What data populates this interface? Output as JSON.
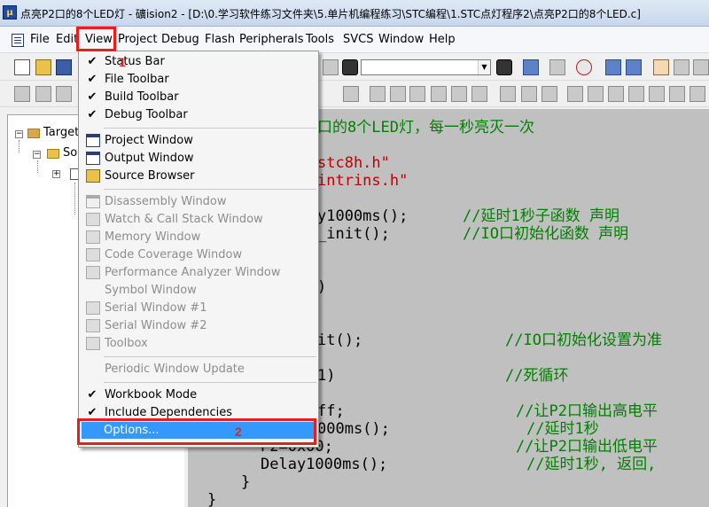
{
  "window": {
    "title": "点亮P2口的8个LED灯  - 礦ision2 - [D:\\0.学习软件练习文件夹\\5.单片机编程练习\\STC编程\\1.STC点灯程序2\\点亮P2口的8个LED.c]"
  },
  "menubar": {
    "items": [
      {
        "id": "file",
        "label": "File"
      },
      {
        "id": "edit",
        "label": "Edit"
      },
      {
        "id": "view",
        "label": "View"
      },
      {
        "id": "project",
        "label": "Project"
      },
      {
        "id": "debug",
        "label": "Debug"
      },
      {
        "id": "flash",
        "label": "Flash"
      },
      {
        "id": "peripherals",
        "label": "Peripherals"
      },
      {
        "id": "tools",
        "label": "Tools"
      },
      {
        "id": "svcs",
        "label": "SVCS"
      },
      {
        "id": "window",
        "label": "Window"
      },
      {
        "id": "help",
        "label": "Help"
      }
    ]
  },
  "toolbar": {
    "find_combo_value": ""
  },
  "view_menu": {
    "items": [
      {
        "label": "Status Bar",
        "checked": true,
        "enabled": true
      },
      {
        "label": "File Toolbar",
        "checked": true,
        "enabled": true
      },
      {
        "label": "Build Toolbar",
        "checked": true,
        "enabled": true
      },
      {
        "label": "Debug Toolbar",
        "checked": true,
        "enabled": true
      },
      {
        "label": "Project Window",
        "icon": "project-window-icon",
        "enabled": true
      },
      {
        "label": "Output Window",
        "icon": "output-window-icon",
        "enabled": true
      },
      {
        "label": "Source Browser",
        "icon": "source-browser-icon",
        "enabled": true
      },
      {
        "label": "Disassembly Window",
        "icon": "disassembly-window-icon",
        "enabled": false
      },
      {
        "label": "Watch & Call Stack Window",
        "icon": "watch-window-icon",
        "enabled": false
      },
      {
        "label": "Memory Window",
        "icon": "memory-window-icon",
        "enabled": false
      },
      {
        "label": "Code Coverage Window",
        "icon": "code-coverage-icon",
        "enabled": false
      },
      {
        "label": "Performance Analyzer Window",
        "icon": "performance-analyzer-icon",
        "enabled": false
      },
      {
        "label": "Symbol Window",
        "enabled": false
      },
      {
        "label": "Serial  Window #1",
        "icon": "serial-window-icon",
        "enabled": false
      },
      {
        "label": "Serial  Window #2",
        "icon": "serial-window-icon",
        "enabled": false
      },
      {
        "label": "Toolbox",
        "icon": "toolbox-icon",
        "enabled": false
      },
      {
        "label": "Periodic Window Update",
        "enabled": false
      },
      {
        "label": "Workbook Mode",
        "checked": true,
        "enabled": true
      },
      {
        "label": "Include Dependencies",
        "checked": true,
        "enabled": true
      }
    ],
    "highlighted_item": "Options...",
    "checkmark": "✔"
  },
  "project_tree": {
    "root_label": "Target",
    "group_label": "So"
  },
  "editor": {
    "lines": [
      {
        "text": "口的8个LED灯，每一秒亮灭一次",
        "kind": "comment"
      },
      {
        "text": "stc8h.h\"",
        "kind": "string"
      },
      {
        "text": "intrins.h\"",
        "kind": "string"
      },
      {
        "text": "y1000ms();    //延时1秒子函数 声明",
        "kind": "mixed",
        "code": "y1000ms();",
        "comment": "//延时1秒子函数 声明"
      },
      {
        "text": "_init();      //IO口初始化函数 声明",
        "kind": "mixed",
        "code": "_init();",
        "comment": "//IO口初始化函数 声明"
      },
      {
        "text": ")",
        "kind": "normal"
      },
      {
        "text": "it();",
        "kind": "mixed",
        "code": "it();",
        "comment": "//IO口初始化设置为准"
      },
      {
        "text": "1)",
        "kind": "mixed",
        "code": "1)",
        "comment": "//死循环"
      },
      {
        "text": "ff;",
        "kind": "mixed",
        "code": "ff;",
        "comment": "//让P2口输出高电平"
      },
      {
        "text": "000ms();",
        "kind": "mixed",
        "code": "000ms();",
        "comment": "//延时1秒"
      },
      {
        "text": "P2=0x00;",
        "kind": "mixed",
        "code": "P2=0x00;",
        "comment": "//让P2口输出低电平"
      },
      {
        "text": "Delay1000ms();",
        "kind": "mixed",
        "code": "Delay1000ms();",
        "comment": "//延时1秒, 返回,"
      },
      {
        "text": "}",
        "kind": "normal"
      },
      {
        "text": "}",
        "kind": "normal"
      }
    ]
  },
  "annotations": {
    "step1": "1",
    "step2": "2"
  },
  "colors": {
    "highlight": "#3399ff",
    "annotation_red": "#ee1b1b",
    "comment_green": "#008000",
    "string_red": "#c00000",
    "editor_bg": "#c0c0c0"
  }
}
